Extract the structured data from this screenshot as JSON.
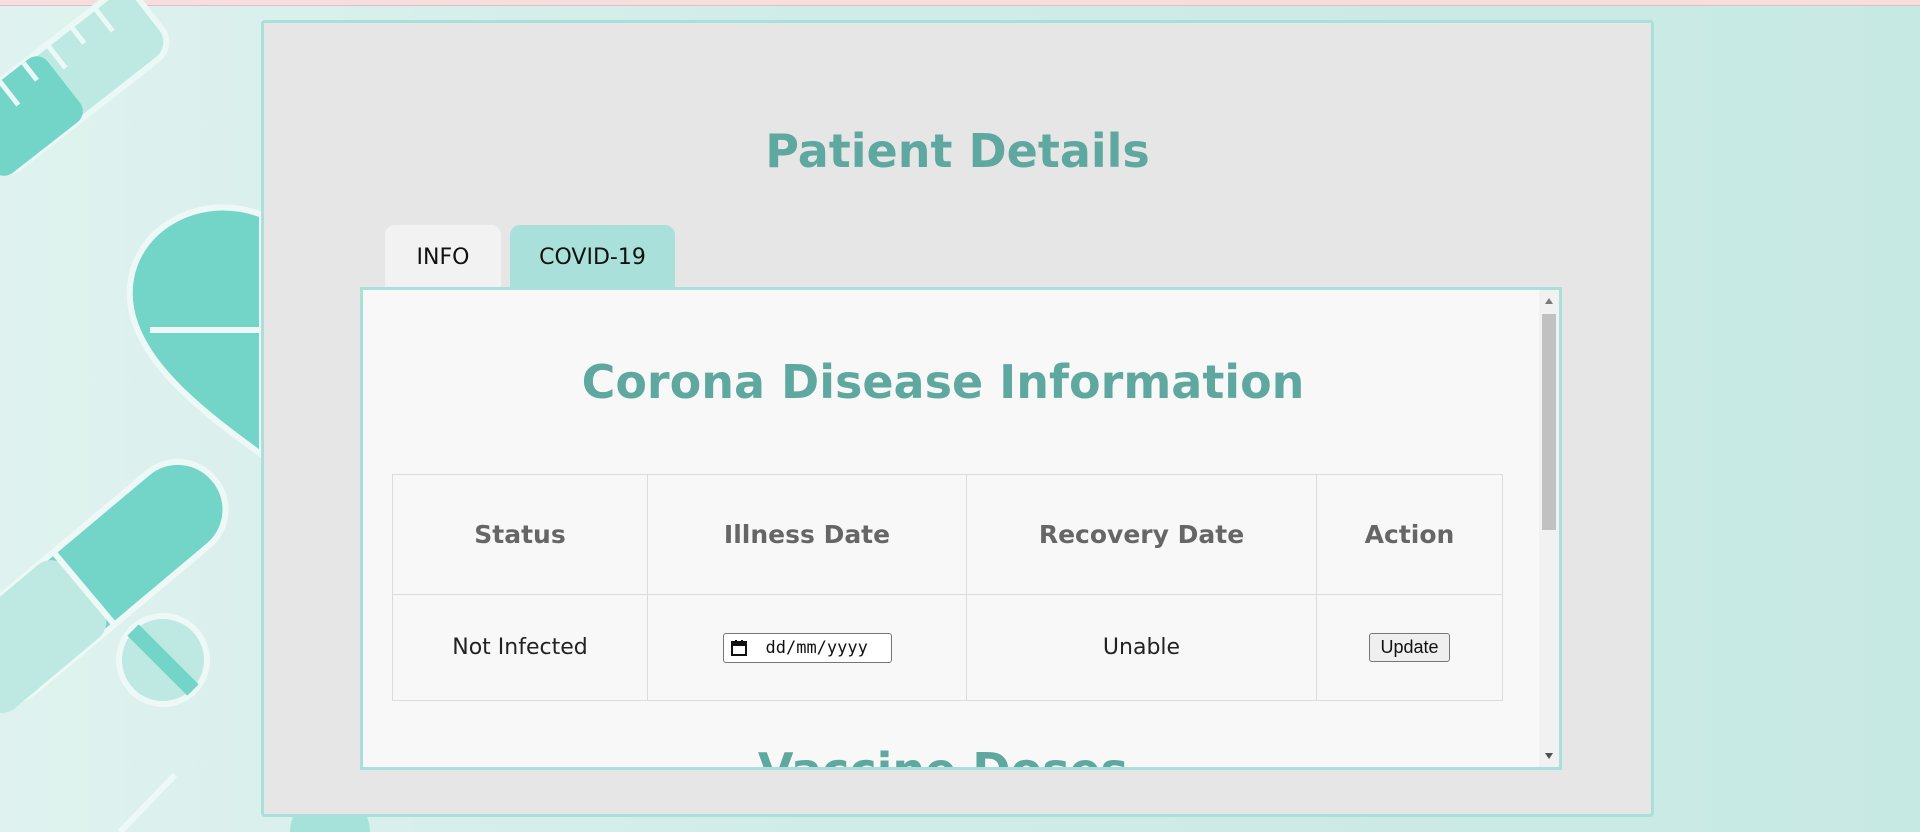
{
  "page": {
    "title": "Patient Details"
  },
  "tabs": [
    {
      "label": "INFO",
      "active": false
    },
    {
      "label": "COVID-19",
      "active": true
    }
  ],
  "covid_section": {
    "title": "Corona Disease Information",
    "table": {
      "headers": [
        "Status",
        "Illness Date",
        "Recovery Date",
        "Action"
      ],
      "rows": [
        {
          "status": "Not Infected",
          "illness_date_placeholder": "dd/mm/yyyy",
          "recovery_date": "Unable",
          "action_label": "Update"
        }
      ]
    }
  },
  "vaccine_section": {
    "title": "Vaccine Doses"
  },
  "colors": {
    "accent": "#a9e1da",
    "heading": "#5fa8a0",
    "panel_bg": "#e6e6e6",
    "content_bg": "#f8f8f8"
  }
}
